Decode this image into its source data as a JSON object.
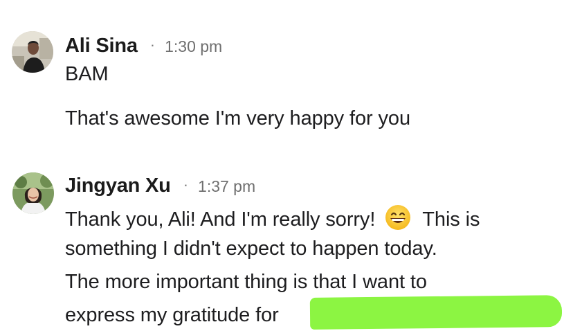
{
  "messages": [
    {
      "sender": "Ali Sina",
      "separator": "·",
      "time": "1:30 pm",
      "lines": [
        "BAM",
        "That's awesome I'm very happy for you"
      ]
    },
    {
      "sender": "Jingyan Xu",
      "separator": "·",
      "time": "1:37 pm",
      "lines": [
        "Thank you, Ali! And I'm really sorry!",
        "This is",
        "something I didn't expect to happen today.",
        "The more important thing is that I want to",
        "express my gratitude for"
      ]
    }
  ],
  "colors": {
    "highlight": "#8cf542",
    "text": "#1d1d1f",
    "time": "#6f6f6f"
  },
  "icons": {
    "emoji": "grinning-face-with-smiling-eyes"
  }
}
